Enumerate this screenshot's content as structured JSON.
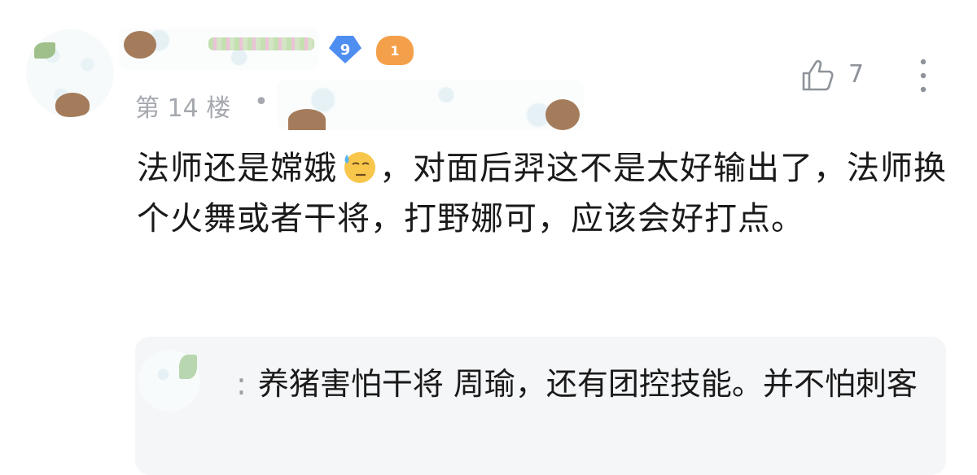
{
  "post": {
    "floor_label": "第 14 楼",
    "separator": "•",
    "level_badge": "9",
    "medal_badge": "1",
    "like_count": "7",
    "content_part1": "法师还是嫦娥",
    "content_part2": "，对面后羿这不是太好输出了，法师换个火舞或者干将，打野娜可，应该会好打点。",
    "emoji_icon": "sweat-emoji-icon"
  },
  "reply": {
    "separator": ":",
    "text": "养猪害怕干将 周瑜，还有团控技能。并不怕刺客"
  },
  "colors": {
    "level_badge": "#4d8ef0",
    "medal_badge": "#f4a04a",
    "reply_bg": "#f5f6f8",
    "meta_text": "#a5a8ae"
  }
}
